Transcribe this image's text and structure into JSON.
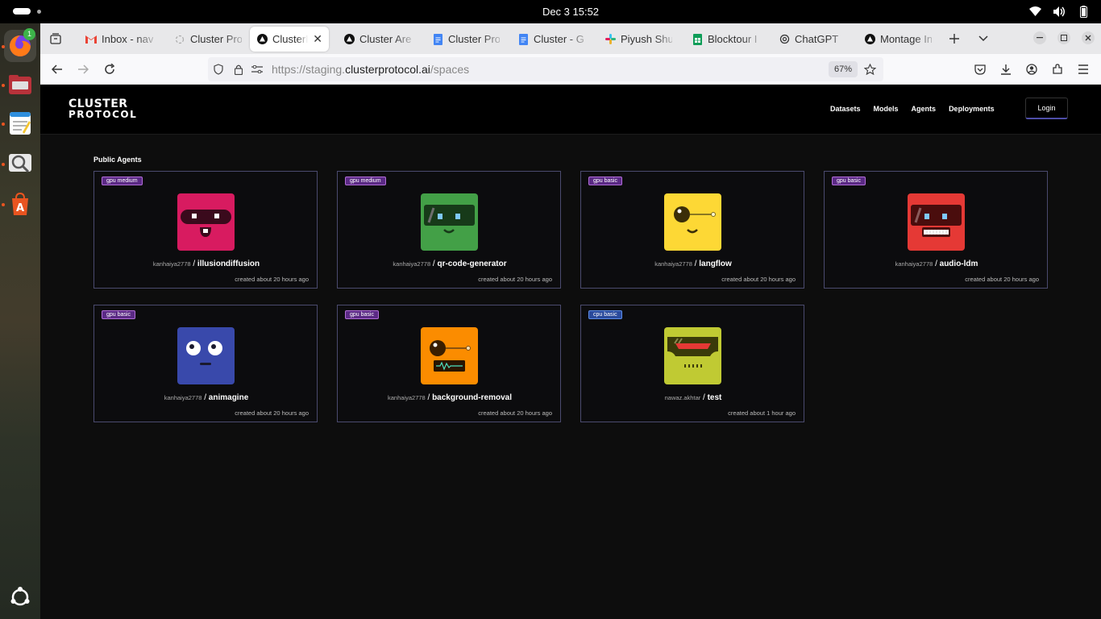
{
  "system": {
    "clock": "Dec 3  15:52"
  },
  "dock": {
    "items": [
      {
        "name": "Firefox",
        "badge": "1"
      },
      {
        "name": "Files"
      },
      {
        "name": "Text Editor"
      },
      {
        "name": "Image Viewer"
      },
      {
        "name": "App Center"
      },
      {
        "name": "Show Apps"
      }
    ]
  },
  "tabs": [
    {
      "label": "Inbox - nav",
      "icon": "gmail-icon"
    },
    {
      "label": "Cluster Pro",
      "icon": "loading-icon"
    },
    {
      "label": "ClusterP",
      "icon": "triangle-icon",
      "active": true
    },
    {
      "label": "Cluster Are",
      "icon": "triangle-icon"
    },
    {
      "label": "Cluster Pro",
      "icon": "docs-icon"
    },
    {
      "label": "Cluster - G",
      "icon": "docs-icon"
    },
    {
      "label": "Piyush Shu",
      "icon": "slack-icon"
    },
    {
      "label": "Blocktour I",
      "icon": "sheets-icon"
    },
    {
      "label": "ChatGPT",
      "icon": "chatgpt-icon"
    },
    {
      "label": "Montage In",
      "icon": "triangle-icon"
    }
  ],
  "address": {
    "scheme": "https://staging.",
    "host": "clusterprotocol.ai",
    "path": "/spaces",
    "zoom": "67%"
  },
  "site": {
    "logo_line1": "CLUSTER",
    "logo_line2": "PROTOCOL",
    "nav": [
      "Datasets",
      "Models",
      "Agents",
      "Deployments"
    ],
    "login": "Login",
    "section_title": "Public Agents"
  },
  "agents": [
    {
      "badge": "gpu medium",
      "owner": "kanhaiya2778",
      "name": "illusiondiffusion",
      "created": "created about 20 hours ago",
      "color": "#d81b60"
    },
    {
      "badge": "gpu medium",
      "owner": "kanhaiya2778",
      "name": "qr-code-generator",
      "created": "created about 20 hours ago",
      "color": "#43a047"
    },
    {
      "badge": "gpu basic",
      "owner": "kanhaiya2778",
      "name": "langflow",
      "created": "created about 20 hours ago",
      "color": "#fdd835"
    },
    {
      "badge": "gpu basic",
      "owner": "kanhaiya2778",
      "name": "audio-ldm",
      "created": "created about 20 hours ago",
      "color": "#e53935"
    },
    {
      "badge": "gpu basic",
      "owner": "kanhaiya2778",
      "name": "animagine",
      "created": "created about 20 hours ago",
      "color": "#3949ab"
    },
    {
      "badge": "gpu basic",
      "owner": "kanhaiya2778",
      "name": "background-removal",
      "created": "created about 20 hours ago",
      "color": "#fb8c00"
    },
    {
      "badge": "cpu basic",
      "owner": "nawaz.akhtar",
      "name": "test",
      "created": "created about 1 hour ago",
      "color": "#c0ca33"
    }
  ]
}
